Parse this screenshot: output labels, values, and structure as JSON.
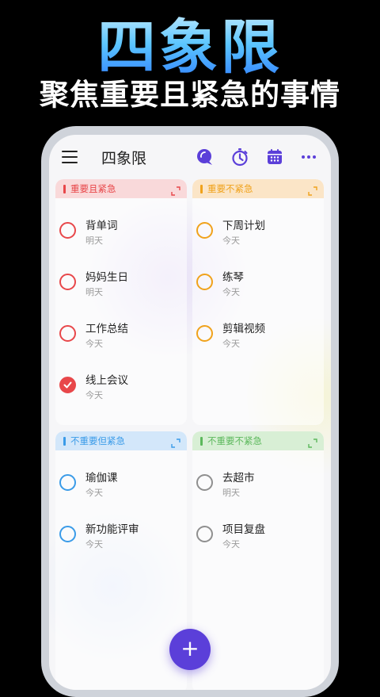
{
  "hero": {
    "title": "四象限",
    "subtitle": "聚焦重要且紧急的事情"
  },
  "app": {
    "title": "四象限",
    "toolbar_icons": [
      "search-bubble-icon",
      "timer-icon",
      "calendar-icon",
      "more-icon"
    ],
    "accent_color": "#5b3fd9"
  },
  "quadrants": [
    {
      "label": "重要且紧急",
      "color": "#e8474a",
      "head_bg": "#f9d9da",
      "tasks": [
        {
          "name": "背单词",
          "due": "明天",
          "done": false
        },
        {
          "name": "妈妈生日",
          "due": "明天",
          "done": false
        },
        {
          "name": "工作总结",
          "due": "今天",
          "done": false
        },
        {
          "name": "线上会议",
          "due": "今天",
          "done": true
        }
      ]
    },
    {
      "label": "重要不紧急",
      "color": "#f0a21b",
      "head_bg": "#fbe5c7",
      "tasks": [
        {
          "name": "下周计划",
          "due": "今天",
          "done": false
        },
        {
          "name": "练琴",
          "due": "今天",
          "done": false
        },
        {
          "name": "剪辑视频",
          "due": "今天",
          "done": false
        }
      ]
    },
    {
      "label": "不重要但紧急",
      "color": "#3a9be8",
      "head_bg": "#d3e7fa",
      "tasks": [
        {
          "name": "瑜伽课",
          "due": "今天",
          "done": false
        },
        {
          "name": "新功能评审",
          "due": "今天",
          "done": false
        }
      ]
    },
    {
      "label": "不重要不紧急",
      "color": "#5cb85c",
      "head_bg": "#d8efd5",
      "tasks": [
        {
          "name": "去超市",
          "due": "明天",
          "done": false
        },
        {
          "name": "项目复盘",
          "due": "今天",
          "done": false
        }
      ]
    }
  ],
  "fab_label": "+"
}
